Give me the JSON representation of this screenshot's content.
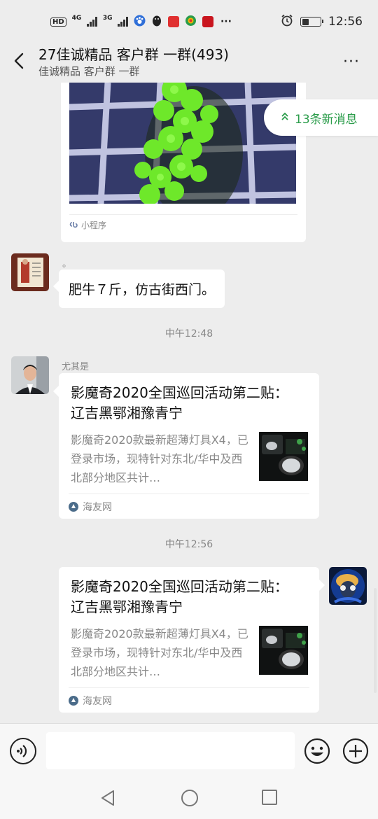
{
  "status_bar": {
    "hd_label": "HD",
    "sim1": "1",
    "net1": "4G",
    "net2": "3G",
    "time": "12:56",
    "icons": [
      "baidu-paw-icon",
      "qq-penguin-icon",
      "news-icon",
      "browser-icon",
      "party-icon",
      "more-dots-icon",
      "alarm-icon",
      "battery-icon"
    ]
  },
  "header": {
    "title": "27佳诚精品 客户群 一群(493)",
    "subtitle": "佳诚精品 客户群 一群",
    "more": "···"
  },
  "chat": {
    "mini_program_label": "小程序",
    "new_messages_label": "13条新消息",
    "messages": [
      {
        "sender": "。",
        "text": "肥牛７斤，仿古街西门。"
      }
    ],
    "time_1": "中午12:48",
    "link_1": {
      "sender": "尤其是",
      "title": "影魔奇2020全国巡回活动第二贴： 辽吉黑鄂湘豫青宁",
      "desc": "影魔奇2020款最新超薄灯具X4，已登录市场，现特针对东北/华中及西北部分地区共计…",
      "source": "海友网"
    },
    "time_2": "中午12:56",
    "link_2": {
      "title": "影魔奇2020全国巡回活动第二贴： 辽吉黑鄂湘豫青宁",
      "desc": "影魔奇2020款最新超薄灯具X4，已登录市场，现特针对东北/华中及西北部分地区共计…",
      "source": "海友网"
    }
  },
  "input_bar": {
    "value": "",
    "placeholder": ""
  },
  "colors": {
    "background": "#ededed",
    "new_message_green": "#2a9c4a",
    "bubble": "#ffffff"
  }
}
